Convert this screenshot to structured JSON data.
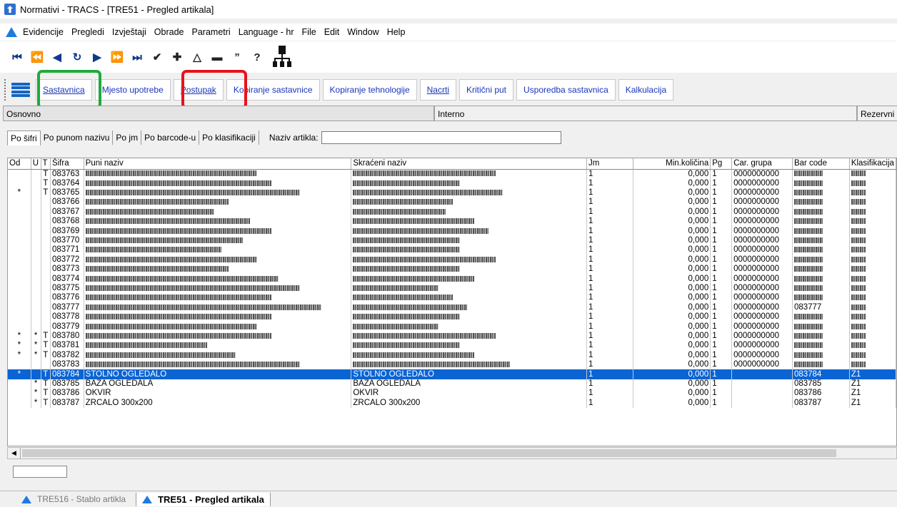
{
  "window": {
    "title": "Normativi - TRACS - [TRE51 - Pregled artikala]"
  },
  "menu": [
    "Evidencije",
    "Pregledi",
    "Izvještaji",
    "Obrade",
    "Parametri",
    "Language - hr",
    "File",
    "Edit",
    "Window",
    "Help"
  ],
  "toolbar": [
    "⏮",
    "⏪",
    "◀",
    "↻",
    "▶",
    "⏩",
    "⏭",
    "✔",
    "✚",
    "△",
    "▬",
    "”",
    "?"
  ],
  "funcbuttons": [
    "Sastavnica",
    "Mjesto upotrebe",
    "Postupak",
    "Kopiranje sastavnice",
    "Kopiranje tehnologije",
    "Nacrti",
    "Kritični put",
    "Usporedba sastavnica",
    "Kalkulacija"
  ],
  "sections": [
    "Osnovno",
    "Interno",
    "Rezervni"
  ],
  "searchtabs": [
    "Po šifri",
    "Po punom nazivu",
    "Po jm",
    "Po barcode-u",
    "Po klasifikaciji"
  ],
  "naziv_label": "Naziv artikla:",
  "naziv_value": "",
  "columns": [
    "Od",
    "U",
    "T",
    "Šifra",
    "Puni naziv",
    "Skraćeni naziv",
    "Jm",
    "Min.količina",
    "Pg",
    "Car. grupa",
    "Bar code",
    "Klasifikacija"
  ],
  "rows": [
    {
      "od": "",
      "u": "",
      "t": "T",
      "sifra": "083763",
      "jm": "1",
      "min": "0,000",
      "pg": "1",
      "car": "0000000000",
      "bc": "",
      "kl": "",
      "sel": false
    },
    {
      "od": "",
      "u": "",
      "t": "T",
      "sifra": "083764",
      "jm": "1",
      "min": "0,000",
      "pg": "1",
      "car": "0000000000",
      "bc": "",
      "kl": "",
      "sel": false
    },
    {
      "od": "*",
      "u": "",
      "t": "T",
      "sifra": "083765",
      "jm": "1",
      "min": "0,000",
      "pg": "1",
      "car": "0000000000",
      "bc": "",
      "kl": "",
      "sel": false
    },
    {
      "od": "",
      "u": "",
      "t": "",
      "sifra": "083766",
      "jm": "1",
      "min": "0,000",
      "pg": "1",
      "car": "0000000000",
      "bc": "",
      "kl": "",
      "sel": false
    },
    {
      "od": "",
      "u": "",
      "t": "",
      "sifra": "083767",
      "jm": "1",
      "min": "0,000",
      "pg": "1",
      "car": "0000000000",
      "bc": "",
      "kl": "",
      "sel": false
    },
    {
      "od": "",
      "u": "",
      "t": "",
      "sifra": "083768",
      "jm": "1",
      "min": "0,000",
      "pg": "1",
      "car": "0000000000",
      "bc": "",
      "kl": "",
      "sel": false
    },
    {
      "od": "",
      "u": "",
      "t": "",
      "sifra": "083769",
      "jm": "1",
      "min": "0,000",
      "pg": "1",
      "car": "0000000000",
      "bc": "",
      "kl": "",
      "sel": false
    },
    {
      "od": "",
      "u": "",
      "t": "",
      "sifra": "083770",
      "jm": "1",
      "min": "0,000",
      "pg": "1",
      "car": "0000000000",
      "bc": "",
      "kl": "",
      "sel": false
    },
    {
      "od": "",
      "u": "",
      "t": "",
      "sifra": "083771",
      "jm": "1",
      "min": "0,000",
      "pg": "1",
      "car": "0000000000",
      "bc": "",
      "kl": "",
      "sel": false
    },
    {
      "od": "",
      "u": "",
      "t": "",
      "sifra": "083772",
      "jm": "1",
      "min": "0,000",
      "pg": "1",
      "car": "0000000000",
      "bc": "",
      "kl": "",
      "sel": false
    },
    {
      "od": "",
      "u": "",
      "t": "",
      "sifra": "083773",
      "jm": "1",
      "min": "0,000",
      "pg": "1",
      "car": "0000000000",
      "bc": "",
      "kl": "",
      "sel": false
    },
    {
      "od": "",
      "u": "",
      "t": "",
      "sifra": "083774",
      "jm": "1",
      "min": "0,000",
      "pg": "1",
      "car": "0000000000",
      "bc": "",
      "kl": "",
      "sel": false
    },
    {
      "od": "",
      "u": "",
      "t": "",
      "sifra": "083775",
      "jm": "1",
      "min": "0,000",
      "pg": "1",
      "car": "0000000000",
      "bc": "",
      "kl": "",
      "sel": false
    },
    {
      "od": "",
      "u": "",
      "t": "",
      "sifra": "083776",
      "jm": "1",
      "min": "0,000",
      "pg": "1",
      "car": "0000000000",
      "bc": "",
      "kl": "",
      "sel": false
    },
    {
      "od": "",
      "u": "",
      "t": "",
      "sifra": "083777",
      "jm": "1",
      "min": "0,000",
      "pg": "1",
      "car": "0000000000",
      "bc": "083777",
      "kl": "",
      "sel": false
    },
    {
      "od": "",
      "u": "",
      "t": "",
      "sifra": "083778",
      "jm": "1",
      "min": "0,000",
      "pg": "1",
      "car": "0000000000",
      "bc": "",
      "kl": "",
      "sel": false
    },
    {
      "od": "",
      "u": "",
      "t": "",
      "sifra": "083779",
      "jm": "1",
      "min": "0,000",
      "pg": "1",
      "car": "0000000000",
      "bc": "",
      "kl": "",
      "sel": false
    },
    {
      "od": "*",
      "u": "*",
      "t": "T",
      "sifra": "083780",
      "jm": "1",
      "min": "0,000",
      "pg": "1",
      "car": "0000000000",
      "bc": "",
      "kl": "",
      "sel": false
    },
    {
      "od": "*",
      "u": "*",
      "t": "T",
      "sifra": "083781",
      "jm": "1",
      "min": "0,000",
      "pg": "1",
      "car": "0000000000",
      "bc": "",
      "kl": "",
      "sel": false
    },
    {
      "od": "*",
      "u": "*",
      "t": "T",
      "sifra": "083782",
      "jm": "1",
      "min": "0,000",
      "pg": "1",
      "car": "0000000000",
      "bc": "",
      "kl": "",
      "sel": false
    },
    {
      "od": "",
      "u": "",
      "t": "",
      "sifra": "083783",
      "jm": "1",
      "min": "0,000",
      "pg": "1",
      "car": "0000000000",
      "bc": "",
      "kl": "",
      "sel": false
    },
    {
      "od": "*",
      "u": "",
      "t": "T",
      "sifra": "083784",
      "puni": "STOLNO OGLEDALO",
      "skr": "STOLNO OGLEDALO",
      "jm": "1",
      "min": "0,000",
      "pg": "1",
      "car": "",
      "bc": "083784",
      "kl": "Z1",
      "sel": true
    },
    {
      "od": "",
      "u": "*",
      "t": "T",
      "sifra": "083785",
      "puni": "BAZA OGLEDALA",
      "skr": "BAZA OGLEDALA",
      "jm": "1",
      "min": "0,000",
      "pg": "1",
      "car": "",
      "bc": "083785",
      "kl": "Z1",
      "sel": false
    },
    {
      "od": "",
      "u": "*",
      "t": "T",
      "sifra": "083786",
      "puni": "OKVIR",
      "skr": "OKVIR",
      "jm": "1",
      "min": "0,000",
      "pg": "1",
      "car": "",
      "bc": "083786",
      "kl": "Z1",
      "sel": false
    },
    {
      "od": "",
      "u": "*",
      "t": "T",
      "sifra": "083787",
      "puni": "ZRCALO 300x200",
      "skr": "ZRCALO 300x200",
      "jm": "1",
      "min": "0,000",
      "pg": "1",
      "car": "",
      "bc": "083787",
      "kl": "Z1",
      "sel": false
    }
  ],
  "bottomtabs": [
    "TRE516 - Stablo artikla",
    "TRE51 - Pregled artikala"
  ],
  "colors": {
    "selection": "#0a64d4",
    "highlight_green": "#1faa3c",
    "highlight_red": "#e8121a",
    "link": "#1a35b8"
  }
}
